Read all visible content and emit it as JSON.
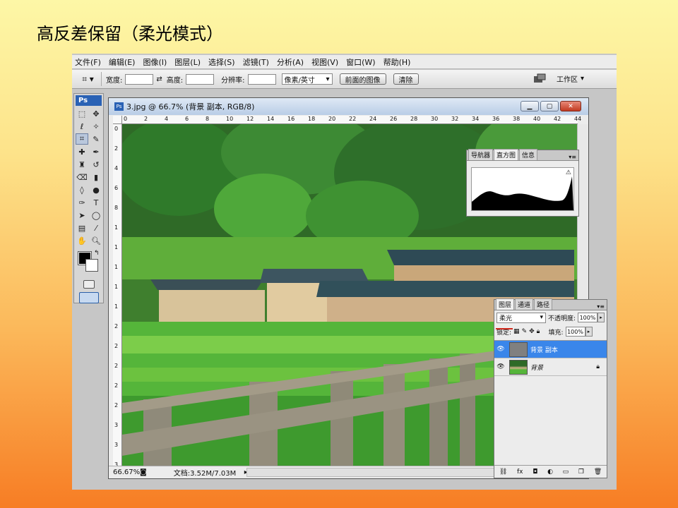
{
  "slide": {
    "title": "高反差保留（柔光模式）"
  },
  "menubar": {
    "items": [
      "文件(F)",
      "编辑(E)",
      "图像(I)",
      "图层(L)",
      "选择(S)",
      "滤镜(T)",
      "分析(A)",
      "视图(V)",
      "窗口(W)",
      "帮助(H)"
    ]
  },
  "options": {
    "width_label": "宽度:",
    "height_label": "高度:",
    "resolution_label": "分辨率:",
    "unit_select": "像素/英寸",
    "front_image_button": "前面的图像",
    "clear_button": "清除",
    "workspace_label": "工作区"
  },
  "toolbox": {
    "logo": "Ps"
  },
  "document": {
    "title": "3.jpg @ 66.7% (背景 副本, RGB/8)",
    "ruler_top": [
      "0",
      "2",
      "4",
      "6",
      "8",
      "10",
      "12",
      "14",
      "16",
      "18",
      "20",
      "22",
      "24",
      "26",
      "28",
      "30",
      "32",
      "34",
      "36",
      "38",
      "40",
      "42",
      "44"
    ],
    "ruler_left": [
      "0",
      "2",
      "4",
      "6",
      "8",
      "1",
      "1",
      "1",
      "1",
      "1",
      "2",
      "2",
      "2",
      "2",
      "2",
      "3",
      "3",
      "3"
    ],
    "zoom": "66.67%",
    "doc_info": "文档:3.52M/7.03M"
  },
  "navigator_panel": {
    "tabs": [
      "导航器",
      "直方图",
      "信息"
    ],
    "active_tab": "直方图"
  },
  "layers_panel": {
    "tabs": [
      "图层",
      "通道",
      "路径"
    ],
    "blend_mode": "柔光",
    "opacity_label": "不透明度:",
    "opacity": "100%",
    "lock_label": "锁定:",
    "fill_label": "填充:",
    "fill": "100%",
    "layers": [
      {
        "name": "背景 副本",
        "selected": true
      },
      {
        "name": "背景",
        "selected": false
      }
    ]
  },
  "colors": {
    "selection": "#3a86ea",
    "foreground": "#000000",
    "background": "#ffffff",
    "annotation": "#d0281b"
  }
}
